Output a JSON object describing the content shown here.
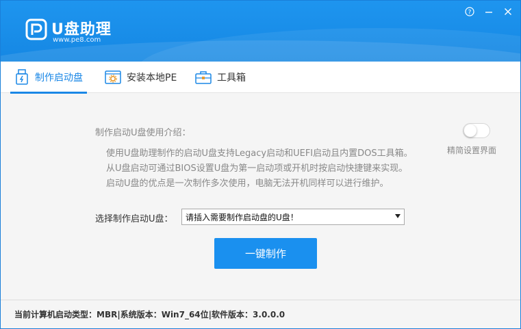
{
  "app": {
    "title": "U盘助理",
    "url": "www.pe8.com",
    "controls": {
      "help": "?",
      "minimize": "—",
      "close": "✕"
    }
  },
  "tabs": [
    {
      "label": "制作启动盘",
      "active": true,
      "icon": "usb-drive-icon"
    },
    {
      "label": "安装本地PE",
      "active": false,
      "icon": "gear-window-icon"
    },
    {
      "label": "工具箱",
      "active": false,
      "icon": "toolbox-icon"
    }
  ],
  "intro": {
    "label": "制作启动U盘使用介绍：",
    "lines": [
      "使用U盘助理制作的启动U盘支持Legacy启动和UEFI启动且内置DOS工具箱。",
      "从U盘启动可通过BIOS设置U盘为第一启动项或开机时按启动快捷键来实现。",
      "启动U盘的优点是一次制作多次使用，电脑无法开机同样可以进行维护。"
    ]
  },
  "simple_mode": {
    "label": "精简设置界面",
    "enabled": false
  },
  "select": {
    "label": "选择制作启动U盘：",
    "value": "请插入需要制作启动盘的U盘！"
  },
  "action": {
    "make_label": "一键制作"
  },
  "status": {
    "text": "当前计算机启动类型：MBR|系统版本：Win7_64位|软件版本：3.0.0.0"
  },
  "colors": {
    "accent": "#1a87e6",
    "header": "#1e95ef",
    "button": "#1a90ef"
  }
}
